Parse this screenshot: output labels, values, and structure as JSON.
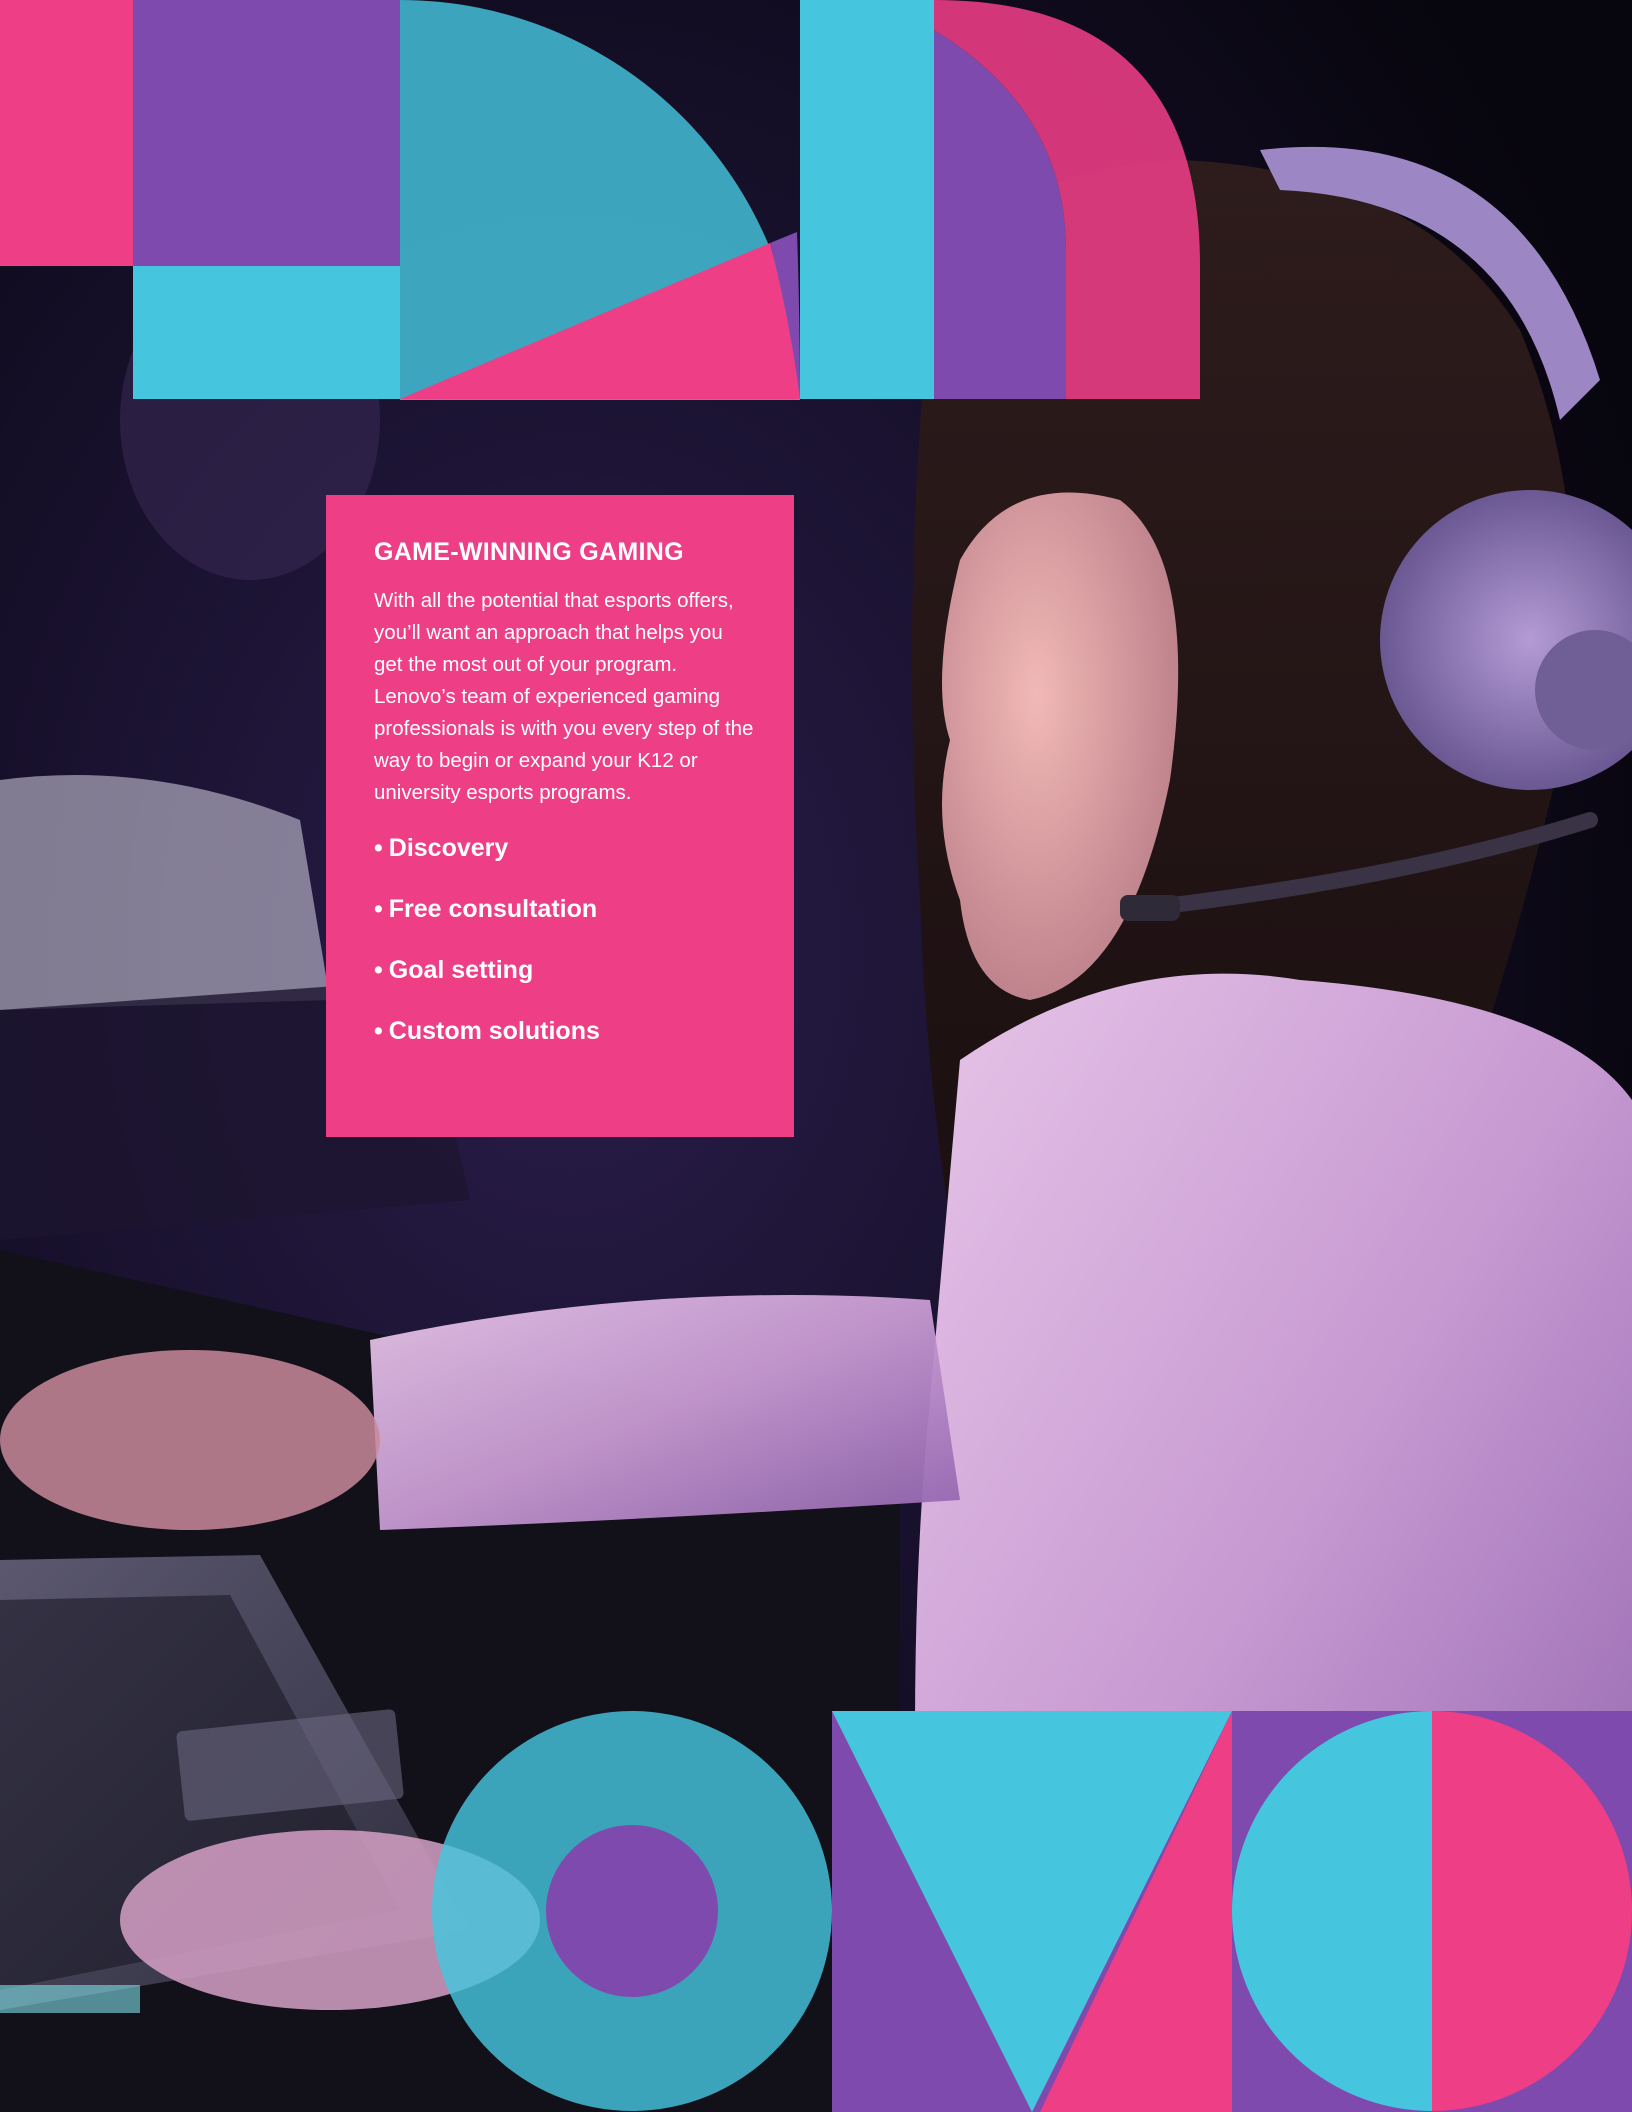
{
  "photo": {
    "subject": "esports-player-with-headset",
    "laptop_brand": "Lenovo"
  },
  "colors": {
    "pink": "#ee3e86",
    "purple": "#7f4aad",
    "cyan": "#45c6de",
    "background": "#0a0712"
  },
  "card": {
    "title": "GAME-WINNING GAMING",
    "body": "With all the potential that esports offers, you’ll want an approach that helps you get the most out of your program. Lenovo’s team of experienced gaming professionals is with you every step of the way to begin or expand your K12 or university esports programs.",
    "bullet_symbol": "•",
    "items": [
      "Discovery",
      "Free consultation",
      "Goal setting",
      "Custom solutions"
    ]
  }
}
